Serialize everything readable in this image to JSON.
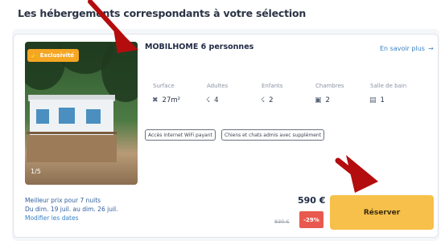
{
  "header": {
    "title": "Les hébergements correspondants à votre sélection"
  },
  "listing": {
    "badge": "Exclusivité",
    "badge_icon": "thumbs-up-icon",
    "photo_counter": "1/5",
    "title": "MOBILHOME 6 personnes",
    "more_link": "En savoir plus",
    "specs": [
      {
        "label": "Surface",
        "value": "27m²",
        "icon": "surface-icon"
      },
      {
        "label": "Adultes",
        "value": "4",
        "icon": "adult-icon"
      },
      {
        "label": "Enfants",
        "value": "2",
        "icon": "child-icon"
      },
      {
        "label": "Chambres",
        "value": "2",
        "icon": "bed-icon"
      },
      {
        "label": "Salle de bain",
        "value": "1",
        "icon": "bath-icon"
      }
    ],
    "tags": [
      "Accès internet WiFi payant",
      "Chiens et chats admis avec supplément"
    ]
  },
  "pricing": {
    "best_price_line": "Meilleur prix pour 7 nuits",
    "dates": "Du dim. 19 juil. au dim. 26 juil.",
    "modify_dates": "Modifier les dates",
    "price": "590 €",
    "old_price": "830 €",
    "discount": "-29%",
    "reserve_label": "Réserver"
  },
  "colors": {
    "accent_button": "#f7c04a",
    "discount": "#e85a4f",
    "link": "#3b82c4",
    "annotation_arrow": "#b30d0d"
  }
}
